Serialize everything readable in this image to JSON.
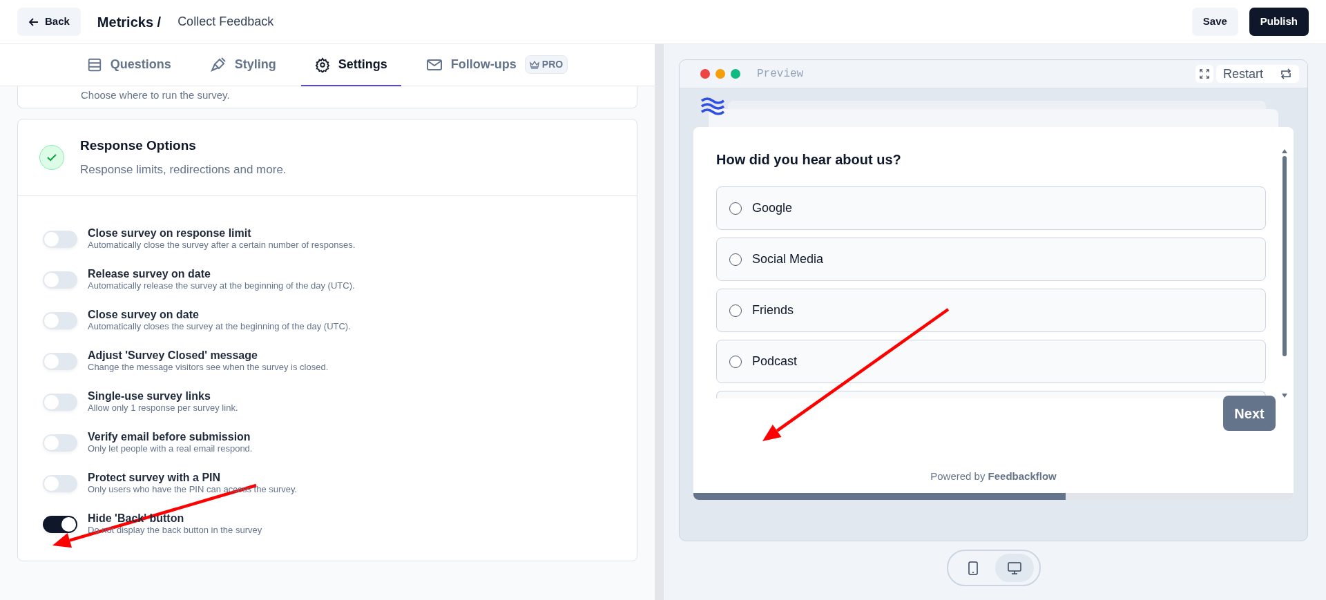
{
  "header": {
    "back_label": "Back",
    "project": "Metricks /",
    "survey_title": "Collect Feedback",
    "save_label": "Save",
    "publish_label": "Publish"
  },
  "tabs": [
    {
      "label": "Questions",
      "selected": false
    },
    {
      "label": "Styling",
      "selected": false
    },
    {
      "label": "Settings",
      "selected": true
    },
    {
      "label": "Follow-ups",
      "selected": false,
      "badge": "PRO"
    }
  ],
  "previous_card": {
    "description": "Choose where to run the survey."
  },
  "response_options": {
    "title": "Response Options",
    "description": "Response limits, redirections and more.",
    "complete": true,
    "options": [
      {
        "title": "Close survey on response limit",
        "description": "Automatically close the survey after a certain number of responses.",
        "on": false
      },
      {
        "title": "Release survey on date",
        "description": "Automatically release the survey at the beginning of the day (UTC).",
        "on": false
      },
      {
        "title": "Close survey on date",
        "description": "Automatically closes the survey at the beginning of the day (UTC).",
        "on": false
      },
      {
        "title": "Adjust 'Survey Closed' message",
        "description": "Change the message visitors see when the survey is closed.",
        "on": false
      },
      {
        "title": "Single-use survey links",
        "description": "Allow only 1 response per survey link.",
        "on": false
      },
      {
        "title": "Verify email before submission",
        "description": "Only let people with a real email respond.",
        "on": false
      },
      {
        "title": "Protect survey with a PIN",
        "description": "Only users who have the PIN can access the survey.",
        "on": false
      },
      {
        "title": "Hide 'Back' button",
        "description": "Do not display the back button in the survey",
        "on": true
      }
    ]
  },
  "preview": {
    "title": "Preview",
    "restart_label": "Restart",
    "question": "How did you hear about us?",
    "choices": [
      {
        "label": "Google",
        "selected": false
      },
      {
        "label": "Social Media",
        "selected": false
      },
      {
        "label": "Friends",
        "selected": false
      },
      {
        "label": "Podcast",
        "selected": false
      }
    ],
    "next_label": "Next",
    "powered_by": "Powered by **Feedbackflow**",
    "progress": {
      "level": 0.62
    }
  },
  "devices": [
    {
      "kind": "mobile",
      "selected": false
    },
    {
      "kind": "desktop",
      "selected": true
    }
  ],
  "annotations": [
    {
      "kind": "arrow"
    },
    {
      "kind": "arrow"
    }
  ]
}
